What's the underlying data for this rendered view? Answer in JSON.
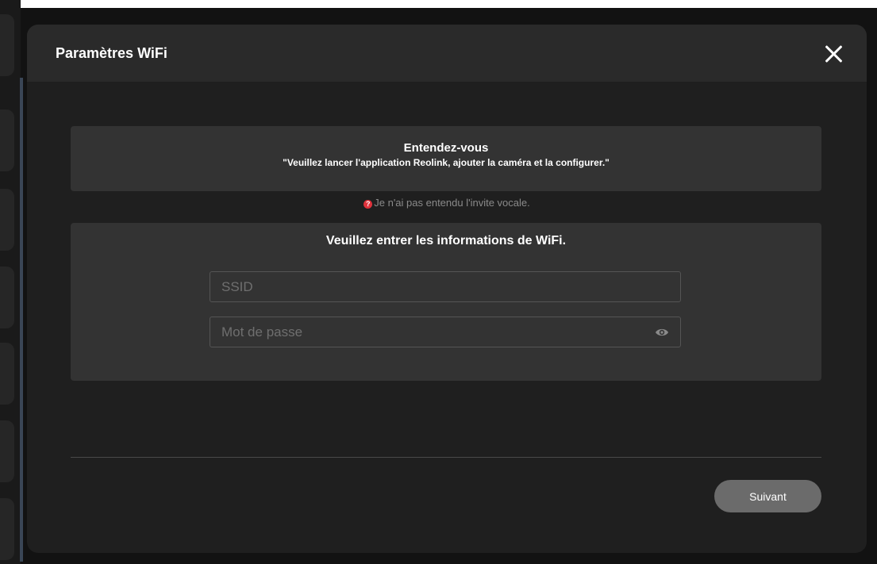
{
  "modal": {
    "title": "Paramètres WiFi",
    "close_icon": "close-icon"
  },
  "hint": {
    "title": "Entendez-vous",
    "message": "\"Veuillez lancer l'application Reolink, ajouter la caméra et la configurer.\""
  },
  "no_voice_link": {
    "icon": "question-icon",
    "icon_glyph": "?",
    "icon_color": "#e0323c",
    "label": "Je n'ai pas entendu l'invite vocale."
  },
  "wifi_form": {
    "title": "Veuillez entrer les informations de WiFi.",
    "ssid": {
      "value": "",
      "placeholder": "SSID"
    },
    "password": {
      "value": "",
      "placeholder": "Mot de passe",
      "toggle_icon": "eye-icon"
    }
  },
  "footer": {
    "next_label": "Suivant"
  }
}
